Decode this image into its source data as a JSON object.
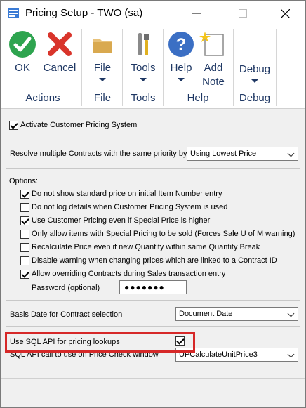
{
  "window": {
    "title": "Pricing Setup  -  TWO (sa)"
  },
  "ribbon": {
    "ok_label": "OK",
    "cancel_label": "Cancel",
    "file_label": "File",
    "tools_label": "Tools",
    "help_label": "Help",
    "add_note_label_1": "Add",
    "add_note_label_2": "Note",
    "debug_label": "Debug",
    "groups": {
      "actions": "Actions",
      "file": "File",
      "tools": "Tools",
      "help": "Help",
      "debug": "Debug"
    }
  },
  "form": {
    "activate_label": "Activate Customer Pricing System",
    "activate_checked": true,
    "resolve_label": "Resolve multiple Contracts with the same priority by",
    "resolve_value": "Using Lowest Price",
    "options_label": "Options:",
    "options": [
      {
        "label": "Do not show standard price on initial Item Number entry",
        "checked": true
      },
      {
        "label": "Do not log details when Customer Pricing System is used",
        "checked": false
      },
      {
        "label": "Use Customer Pricing even if Special Price is higher",
        "checked": true
      },
      {
        "label": "Only allow items with Special Pricing to be sold (Forces Sale U of M warning)",
        "checked": false
      },
      {
        "label": "Recalculate Price even if new Quantity within same Quantity Break",
        "checked": false
      },
      {
        "label": "Disable warning when changing prices which are linked to a Contract ID",
        "checked": false
      },
      {
        "label": "Allow overriding Contracts during Sales transaction entry",
        "checked": true
      }
    ],
    "password_label": "Password (optional)",
    "password_value": "●●●●●●●",
    "basis_label": "Basis Date for Contract selection",
    "basis_value": "Document Date",
    "sql_api_label": "Use SQL API for pricing lookups",
    "sql_api_checked": true,
    "sql_call_label": "SQL API call to use on Price Check window",
    "sql_call_value": "UPCalculateUnitPrice3"
  },
  "colors": {
    "highlight": "#d62828",
    "ok_green": "#2ea44f",
    "cancel_red": "#d9342b",
    "help_blue": "#3b6fc4"
  }
}
